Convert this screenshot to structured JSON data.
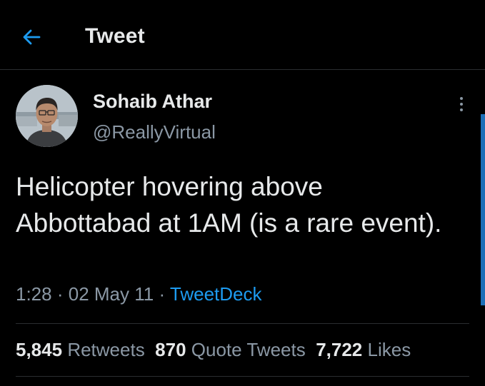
{
  "header": {
    "back_icon": "arrow-left-icon",
    "title": "Tweet"
  },
  "tweet": {
    "author": {
      "name": "Sohaib Athar",
      "handle": "@ReallyVirtual"
    },
    "more_icon": "vertical-ellipsis-icon",
    "text": "Helicopter hovering above Abbottabad at 1AM (is a rare event).",
    "time": "1:28",
    "date": "02 May 11",
    "separator": "·",
    "source": "TweetDeck",
    "stats": {
      "retweets": {
        "count": "5,845",
        "label": "Retweets"
      },
      "quote_tweets": {
        "count": "870",
        "label": "Quote Tweets"
      },
      "likes": {
        "count": "7,722",
        "label": "Likes"
      }
    }
  },
  "colors": {
    "background": "#000000",
    "text_primary": "#e7e9ea",
    "text_secondary": "#8b98a5",
    "accent": "#1d9bf0",
    "divider": "#2a2d30"
  }
}
